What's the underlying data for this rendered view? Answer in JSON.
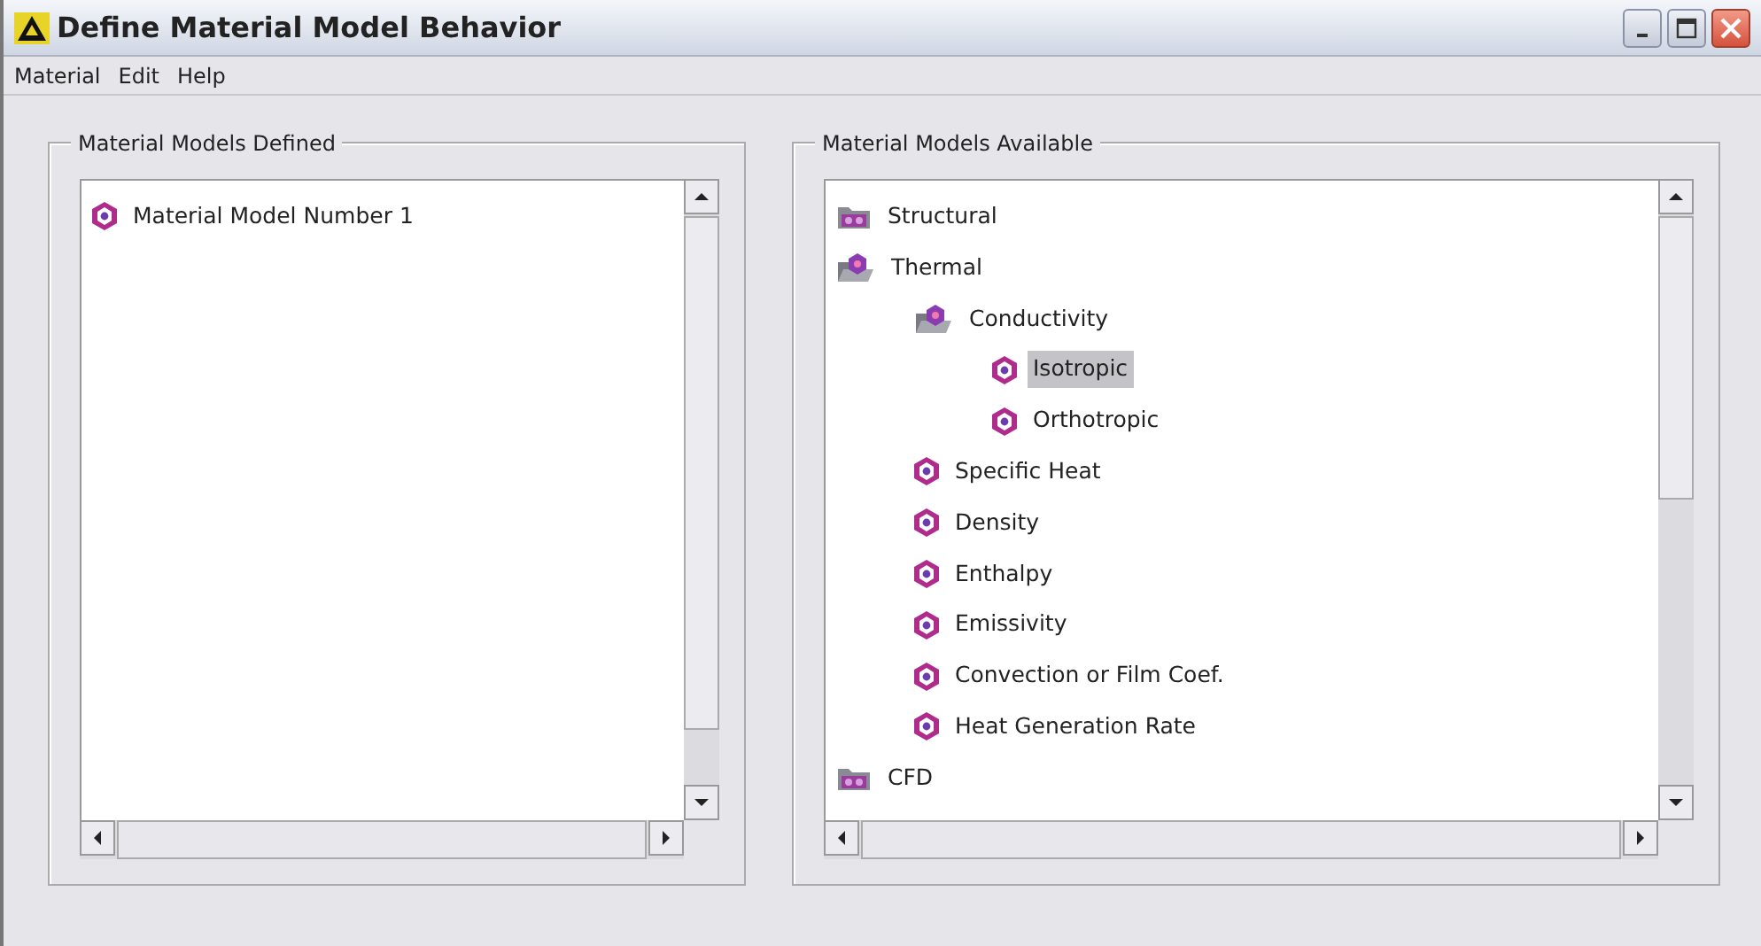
{
  "window": {
    "title": "Define Material Model Behavior"
  },
  "menu": [
    "Material",
    "Edit",
    "Help"
  ],
  "defined": {
    "title": "Material Models Defined",
    "items": [
      {
        "label": "Material Model Number 1",
        "kind": "model",
        "selected": false
      }
    ]
  },
  "available": {
    "title": "Material Models Available",
    "items": [
      {
        "label": "Structural",
        "kind": "folder",
        "expanded": false,
        "selected": false
      },
      {
        "label": "Thermal",
        "kind": "folder",
        "expanded": true,
        "selected": false,
        "children": [
          {
            "label": "Conductivity",
            "kind": "folder",
            "expanded": true,
            "selected": false,
            "children": [
              {
                "label": "Isotropic",
                "kind": "model",
                "selected": true
              },
              {
                "label": "Orthotropic",
                "kind": "model",
                "selected": false
              }
            ]
          },
          {
            "label": "Specific Heat",
            "kind": "model",
            "selected": false
          },
          {
            "label": "Density",
            "kind": "model",
            "selected": false
          },
          {
            "label": "Enthalpy",
            "kind": "model",
            "selected": false
          },
          {
            "label": "Emissivity",
            "kind": "model",
            "selected": false
          },
          {
            "label": "Convection or Film Coef.",
            "kind": "model",
            "selected": false
          },
          {
            "label": "Heat Generation Rate",
            "kind": "model",
            "selected": false
          }
        ]
      },
      {
        "label": "CFD",
        "kind": "folder",
        "expanded": false,
        "selected": false
      }
    ]
  }
}
